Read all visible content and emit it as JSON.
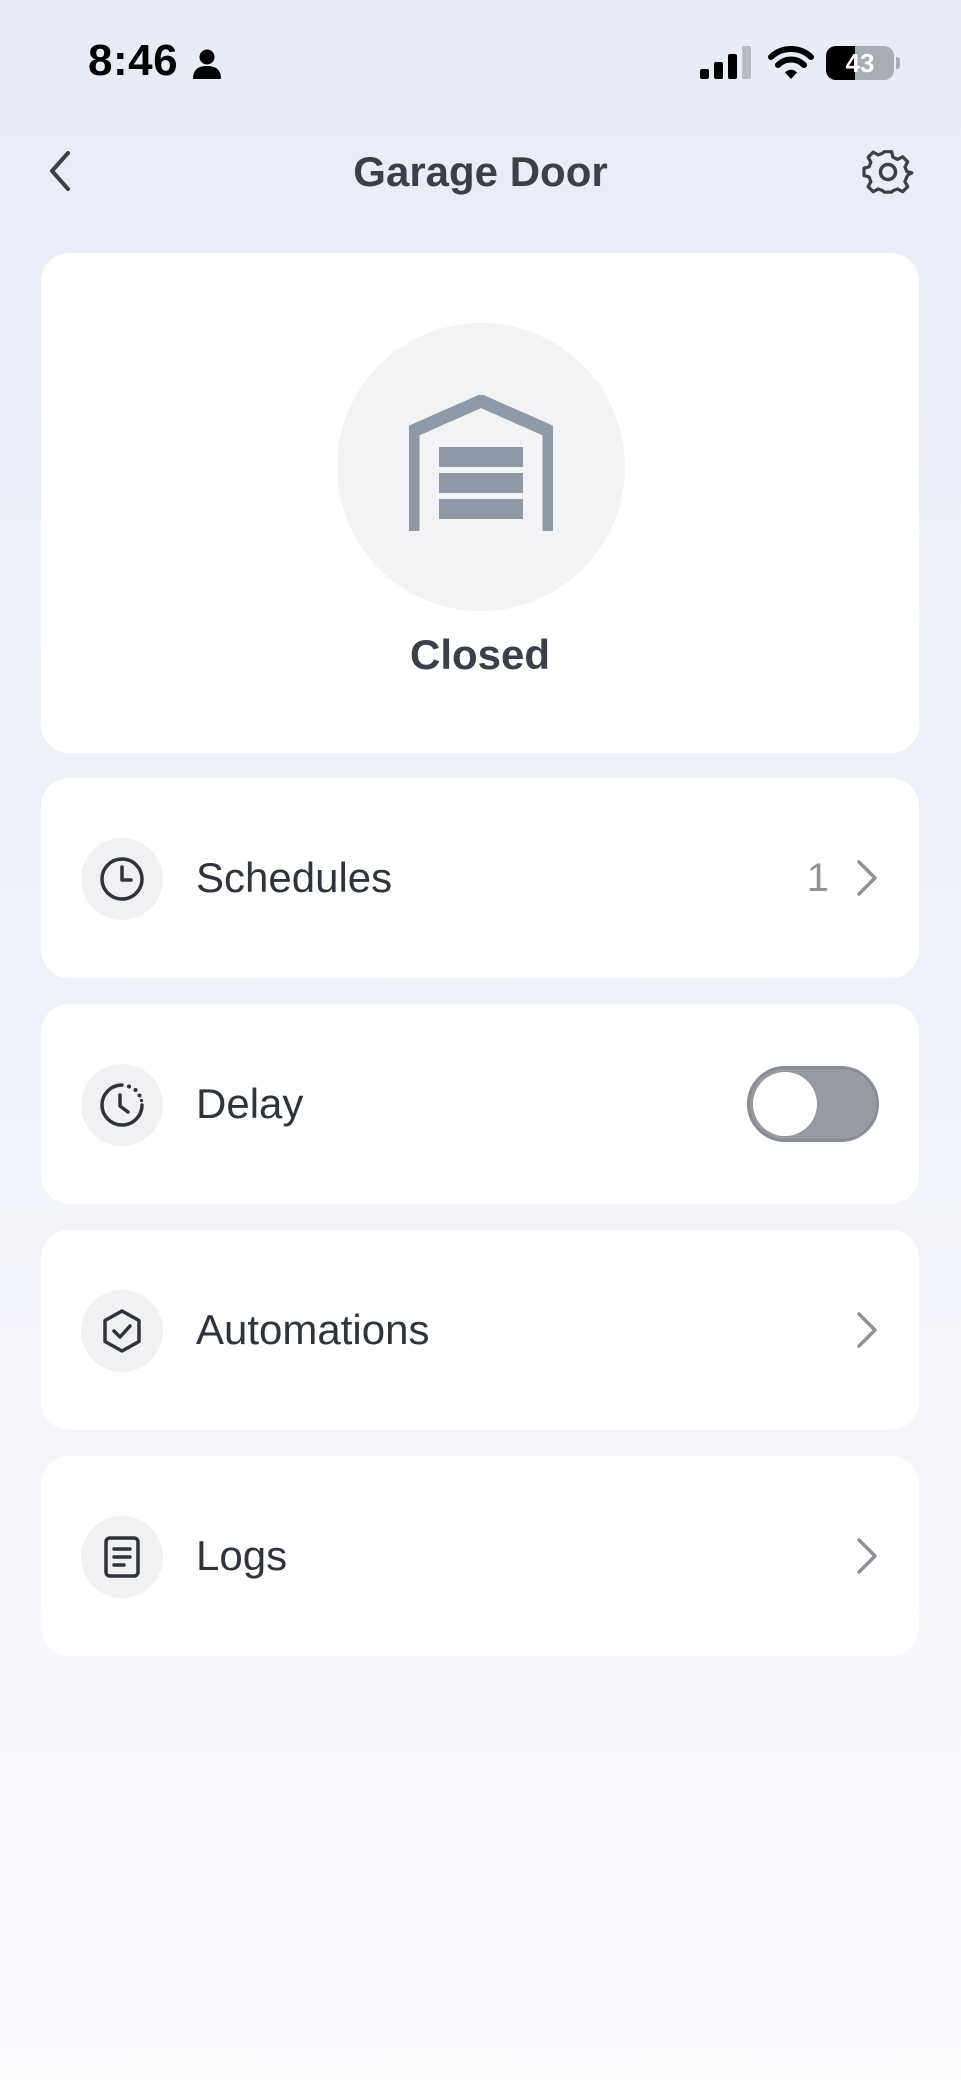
{
  "status_bar": {
    "time": "8:46",
    "battery_level": "43",
    "battery_fraction": 0.43
  },
  "nav": {
    "title": "Garage Door"
  },
  "device": {
    "status": "Closed"
  },
  "rows": {
    "schedules": {
      "label": "Schedules",
      "count": "1"
    },
    "delay": {
      "label": "Delay",
      "toggle_on": false
    },
    "automations": {
      "label": "Automations"
    },
    "logs": {
      "label": "Logs"
    }
  },
  "icons": {
    "back": "chevron-left-icon",
    "settings": "gear-icon",
    "garage": "garage-door-icon",
    "schedules": "clock-icon",
    "delay": "timer-icon",
    "automations": "shield-check-icon",
    "logs": "document-list-icon",
    "chevron": "chevron-right-icon"
  },
  "colors": {
    "background_top": "#e8ecf7",
    "card": "#ffffff",
    "garage_icon": "#8f99a6",
    "toggle_off": "#979aa0",
    "text": "#2e333c"
  }
}
